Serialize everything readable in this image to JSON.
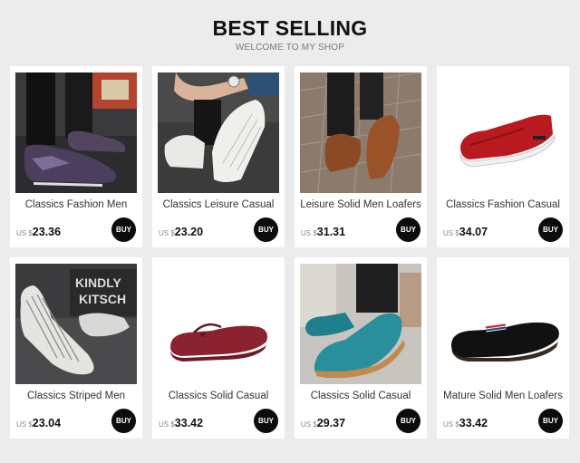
{
  "header": {
    "title": "BEST SELLING",
    "subtitle": "WELCOME TO MY SHOP"
  },
  "products": [
    {
      "name": "Classics Fashion Men",
      "currency": "US $",
      "price": "23.36",
      "buy_label": "BUY",
      "image": "patterned-loafer-worn-photo"
    },
    {
      "name": "Classics Leisure Casual",
      "currency": "US $",
      "price": "23.20",
      "buy_label": "BUY",
      "image": "white-striped-loafer-worn-photo"
    },
    {
      "name": "Leisure Solid Men Loafers",
      "currency": "US $",
      "price": "31.31",
      "buy_label": "BUY",
      "image": "brown-suede-loafer-worn-photo"
    },
    {
      "name": "Classics Fashion Casual",
      "currency": "US $",
      "price": "34.07",
      "buy_label": "BUY",
      "image": "red-slip-on-sneaker-photo"
    },
    {
      "name": "Classics Striped Men",
      "currency": "US $",
      "price": "23.04",
      "buy_label": "BUY",
      "image": "striped-canvas-loafer-photo"
    },
    {
      "name": "Classics Solid Casual",
      "currency": "US $",
      "price": "33.42",
      "buy_label": "BUY",
      "image": "burgundy-driving-moccasin-photo"
    },
    {
      "name": "Classics Solid Casual",
      "currency": "US $",
      "price": "29.37",
      "buy_label": "BUY",
      "image": "teal-suede-loafer-worn-photo"
    },
    {
      "name": "Mature Solid Men Loafers",
      "currency": "US $",
      "price": "33.42",
      "buy_label": "BUY",
      "image": "black-suede-moccasin-photo"
    }
  ]
}
